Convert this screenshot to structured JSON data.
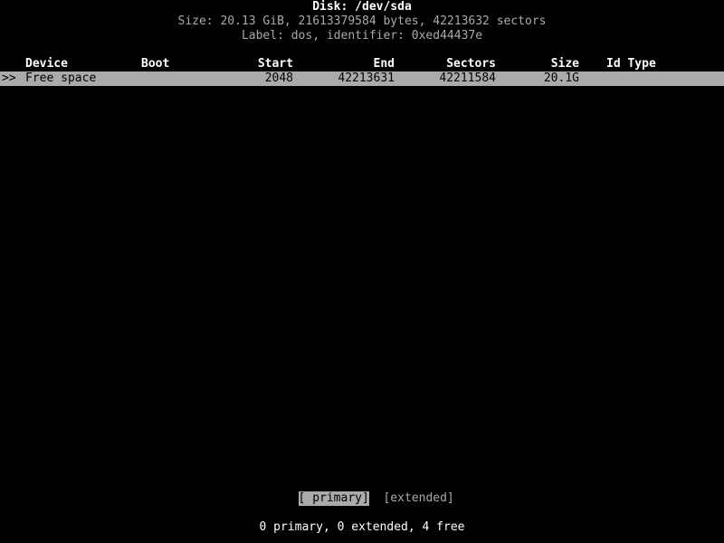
{
  "header": {
    "disk_line": "Disk: /dev/sda",
    "size_line": "Size: 20.13 GiB, 21613379584 bytes, 42213632 sectors",
    "label_line": "Label: dos, identifier: 0xed44437e"
  },
  "table": {
    "columns": {
      "device": "Device",
      "boot": "Boot",
      "start": "Start",
      "end": "End",
      "sectors": "Sectors",
      "size": "Size",
      "id_type": "Id Type"
    },
    "rows": [
      {
        "marker": ">>",
        "device": "Free space",
        "boot": "",
        "start": "2048",
        "end": "42213631",
        "sectors": "42211584",
        "size": "20.1G",
        "id_type": "",
        "selected": true
      }
    ]
  },
  "buttons": [
    {
      "label": "[ primary]",
      "active": true
    },
    {
      "label": "[extended]",
      "active": false
    }
  ],
  "button_gap": "  ",
  "status": {
    "summary": "0 primary, 0 extended, 4 free"
  },
  "colors": {
    "background": "#000000",
    "foreground": "#aaaaaa",
    "bright": "#ffffff",
    "highlight_bg": "#aaaaaa",
    "highlight_fg": "#000000"
  }
}
